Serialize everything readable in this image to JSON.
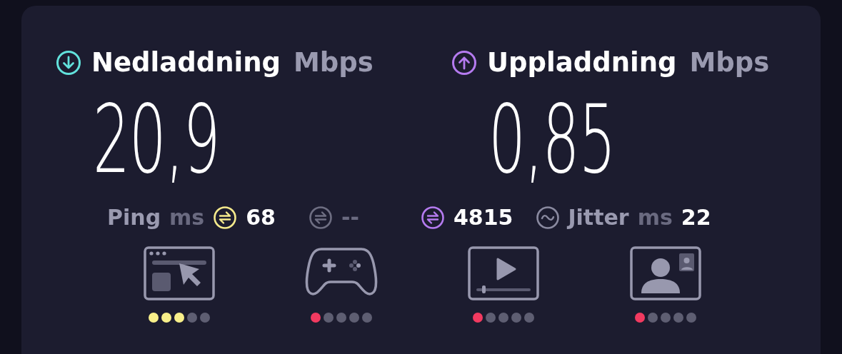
{
  "download": {
    "label": "Nedladdning",
    "unit": "Mbps",
    "value": "20,9"
  },
  "upload": {
    "label": "Uppladdning",
    "unit": "Mbps",
    "value": "0,85"
  },
  "ping": {
    "label": "Ping",
    "unit": "ms",
    "items": [
      {
        "value": "68",
        "color": "#f5ea8c",
        "disabled": false
      },
      {
        "value": "--",
        "color": "#6e6e82",
        "disabled": true
      },
      {
        "value": "4815",
        "color": "#b57bf0",
        "disabled": false
      }
    ]
  },
  "jitter": {
    "label": "Jitter",
    "unit": "ms",
    "value": "22"
  },
  "services": [
    {
      "kind": "browsing",
      "stars": 3,
      "color": "#f8ef8a"
    },
    {
      "kind": "gaming",
      "stars": 1,
      "color": "#f23a60"
    },
    {
      "kind": "video",
      "stars": 1,
      "color": "#f23a60"
    },
    {
      "kind": "videocall",
      "stars": 1,
      "color": "#f23a60"
    }
  ]
}
